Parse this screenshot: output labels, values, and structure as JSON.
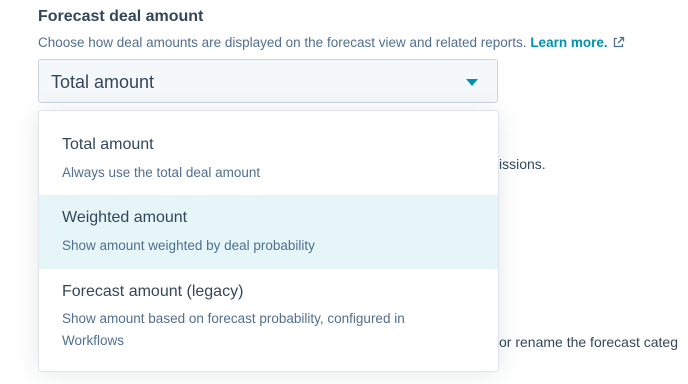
{
  "section": {
    "title": "Forecast deal amount",
    "description": "Choose how deal amounts are displayed on the forecast view and related reports.",
    "learn_more": "Learn more."
  },
  "select": {
    "value": "Total amount"
  },
  "background_text": {
    "line1": "issions.",
    "line2": "or rename the forecast categ"
  },
  "dropdown": {
    "options": [
      {
        "label": "Total amount",
        "description": "Always use the total deal amount",
        "highlighted": false
      },
      {
        "label": "Weighted amount",
        "description": "Show amount weighted by deal probability",
        "highlighted": true
      },
      {
        "label": "Forecast amount (legacy)",
        "description": "Show amount based on forecast probability, configured in Workflows",
        "highlighted": false
      }
    ]
  },
  "colors": {
    "link": "#0091ae",
    "text": "#33475b",
    "muted": "#516f90",
    "highlight": "#e5f5f8"
  },
  "icons": {
    "caret": "caret-down-icon",
    "external": "external-link-icon"
  }
}
